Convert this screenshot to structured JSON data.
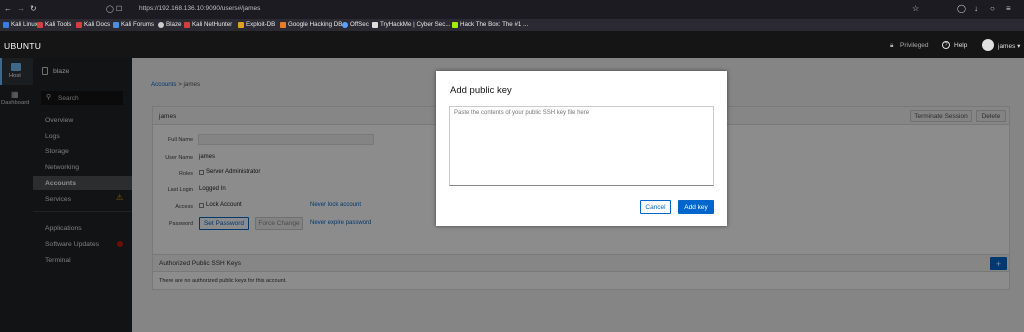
{
  "browser": {
    "url": "https://192.168.136.10:9090/users#/james",
    "bookmarks": [
      {
        "label": "Kali Linux",
        "color": "#367bf0"
      },
      {
        "label": "Kali Tools",
        "color": "#d04040"
      },
      {
        "label": "Kali Docs",
        "color": "#d04040"
      },
      {
        "label": "Kali Forums",
        "color": "#4a8fe0"
      },
      {
        "label": "Blaze",
        "color": "#cccccc"
      },
      {
        "label": "Kali NetHunter",
        "color": "#d04040"
      },
      {
        "label": "Exploit-DB",
        "color": "#e0a020"
      },
      {
        "label": "Google Hacking DB",
        "color": "#e08030"
      },
      {
        "label": "OffSec",
        "color": "#5aa0ff"
      },
      {
        "label": "TryHackMe | Cyber Sec...",
        "color": "#dddddd"
      },
      {
        "label": "Hack The Box: The #1 ...",
        "color": "#9fef00"
      }
    ]
  },
  "header": {
    "hostname": "UBUNTU",
    "privileged": "Privileged",
    "help": "Help",
    "user": "james"
  },
  "leftbar": {
    "host": "Host",
    "dashboard": "Dashboard"
  },
  "nav": {
    "host_name": "blaze",
    "search_placeholder": "Search",
    "items": [
      "Overview",
      "Logs",
      "Storage",
      "Networking",
      "Accounts",
      "Services",
      "Applications",
      "Software Updates",
      "Terminal"
    ]
  },
  "content": {
    "breadcrumb_parent": "Accounts",
    "breadcrumb_sep": ">",
    "breadcrumb_current": "james",
    "card_title": "james",
    "terminate_session": "Terminate Session",
    "delete": "Delete",
    "labels": {
      "full_name": "Full Name",
      "user_name": "User Name",
      "roles": "Roles",
      "last_login": "Last Login",
      "access": "Access",
      "password": "Password"
    },
    "user_name_value": "james",
    "role_server_admin": "Server Administrator",
    "last_login_value": "Logged In",
    "lock_account": "Lock Account",
    "never_lock": "Never lock account",
    "set_password": "Set Password",
    "force_change": "Force Change",
    "never_expire": "Never expire password",
    "ssh_keys_title": "Authorized Public SSH Keys",
    "ssh_keys_empty": "There are no authorized public keys for this account.",
    "add_key_plus": "+"
  },
  "dialog": {
    "title": "Add public key",
    "textarea_placeholder": "Paste the contents of your public SSH key file here",
    "cancel": "Cancel",
    "add_key": "Add key"
  },
  "colors": {
    "primary": "#0066cc",
    "warning": "#f0ab00",
    "danger": "#c9190b"
  }
}
